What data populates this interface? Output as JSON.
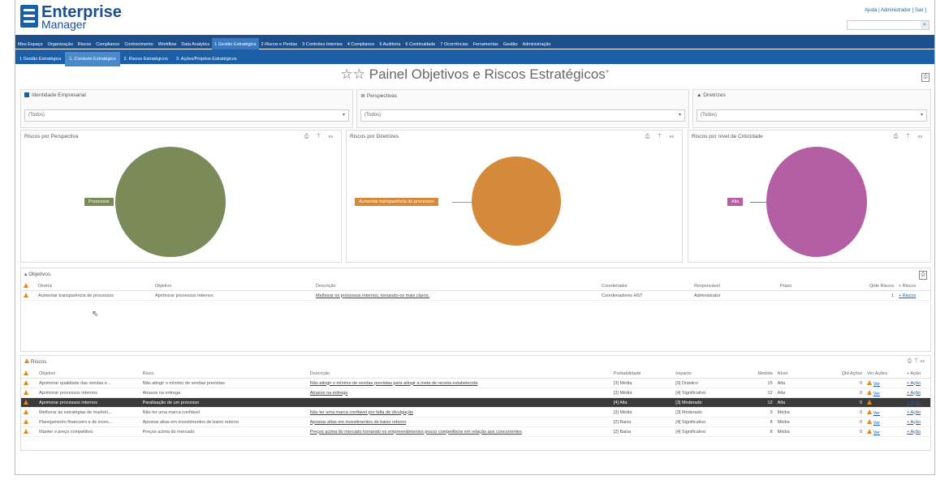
{
  "app": {
    "brand_line1": "Enterprise",
    "brand_line2": "Manager",
    "user_links": "Ajuda | Administrador [ Sair ]"
  },
  "colors": {
    "nav_primary": "#1d4f8c",
    "nav_secondary": "#1d5fa6",
    "processos": "#7a8a58",
    "diretriz": "#d48a3a",
    "alta": "#b45fa3",
    "warning": "#e08a1e"
  },
  "nav_primary": [
    "Meu Espaço",
    "Organização",
    "Riscos",
    "Compliance",
    "Conhecimento",
    "Workflow",
    "Data Analytics",
    "1 Gestão Estratégica",
    "2 Riscos e Perdas",
    "3 Controles Internos",
    "4 Compliance",
    "5 Auditoria",
    "6 Continuidade",
    "7 Ocorrências",
    "Ferramentas",
    "Gestão",
    "Administração"
  ],
  "nav_secondary": [
    "1 Gestão Estratégica",
    "1. Contexto Estratégico",
    "2. Riscos Estratégicos",
    "3. Ações/Projetos Estratégicos"
  ],
  "page_title": "☆☆ Painel Objetivos e Riscos Estratégicos",
  "filters": [
    {
      "label": "Identidade Empresarial",
      "value": "(Todos)"
    },
    {
      "label": "Perspectivas",
      "value": "(Todos)"
    },
    {
      "label": "Diretrizes",
      "value": "(Todos)"
    }
  ],
  "charts": [
    {
      "title": "Riscos por Perspectiva",
      "label": "Processos"
    },
    {
      "title": "Riscos por Diretrizes",
      "label": "Aumentar transparência de processos"
    },
    {
      "title": "Riscos por nível de Criticidade",
      "label": "Alta"
    }
  ],
  "objetivos": {
    "title": "Objetivos",
    "headers": [
      "Diretriz",
      "Objetivo",
      "Descrição",
      "Coordenador",
      "Responsável",
      "Prazo",
      "Qtde Riscos",
      "+ Riscos"
    ],
    "rows": [
      [
        "Aumentar transparência de processos",
        "Aprimorar processos internos",
        "Melhorar os processos internos, tornando-os mais claros.",
        "Coordenadores HST",
        "Administrator",
        "",
        "1",
        "+ Riscos"
      ]
    ]
  },
  "riscos": {
    "title": "Riscos",
    "headers": [
      "Objetivo",
      "Risco",
      "Descrição",
      "Probabilidade",
      "Impacto",
      "Medida",
      "Nível",
      "Qtd Ações",
      "Ver Ações",
      "+ Ação"
    ],
    "rows": [
      [
        "Aprimorar qualidade das vendas e ...",
        "Não atingir o mínimo de vendas previstas",
        "Não atingir o mínimo de vendas previstas para atingir a meta de receita estabelecida",
        "[3] Média",
        "[5] Drástico",
        "15",
        "Alta",
        "0",
        "Ver",
        "+ Ação"
      ],
      [
        "Aprimorar processos internos",
        "Atrasos na entrega",
        "Atrasos na entrega",
        "[3] Média",
        "[4] Significativo",
        "12",
        "Alta",
        "0",
        "Ver",
        "+ Ação"
      ],
      [
        "Aprimorar processos internos",
        "Paralisação de um processo",
        "",
        "[4] Alta",
        "[3] Moderado",
        "12",
        "Alta",
        "0",
        "",
        "+ Ação"
      ],
      [
        "Melhorar as estratégias de marketi...",
        "Não ter uma marca confiável",
        "Não ter uma marca confiável por falta de divulgação",
        "[3] Média",
        "[3] Moderado",
        "9",
        "Média",
        "0",
        "Ver",
        "+ Ação"
      ],
      [
        "Planejamento financeiro e de inves...",
        "Apostas altas em investimentos de baixo retorno",
        "Apostas altas em investimentos de baixo retorno",
        "[2] Baixa",
        "[4] Significativo",
        "8",
        "Média",
        "0",
        "Ver",
        "+ Ação"
      ],
      [
        "Manter o preço competitivo",
        "Preços acima do mercado",
        "Preços acima do mercado tornando os empreendimentos pouco competitivos em relação aos concorrentes",
        "[2] Baixa",
        "[4] Significativo",
        "8",
        "Média",
        "0",
        "Ver",
        "+ Ação"
      ]
    ]
  }
}
